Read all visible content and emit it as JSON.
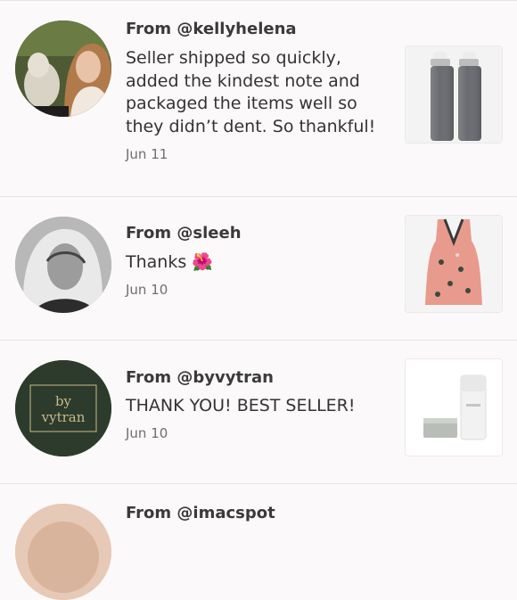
{
  "reviews": [
    {
      "from": "From @kellyhelena",
      "text": "Seller shipped so quickly, added the kindest note and packaged the items well so they didn’t dent. So thankful!",
      "date": "Jun 11"
    },
    {
      "from": "From @sleeh",
      "text": "Thanks",
      "emoji": "🌺",
      "date": "Jun 10"
    },
    {
      "from": "From @byvytran",
      "text": "THANK YOU! BEST SELLER!",
      "date": "Jun 10",
      "avatar_logo": {
        "line1": "by",
        "line2": "vytran"
      }
    },
    {
      "from": "From @imacspot"
    }
  ],
  "colors": {
    "background": "#fbf9f9",
    "divider": "#e8e5e5",
    "avatar_green": "#2d3b2c",
    "logo_gold": "#c9b98b",
    "top_pink": "#e89a8d"
  }
}
